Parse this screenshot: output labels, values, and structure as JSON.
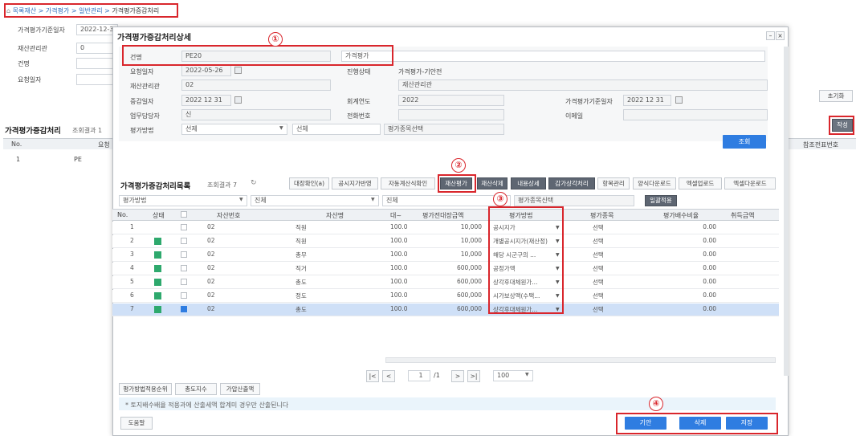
{
  "breadcrumb": [
    "목록재산",
    "가격평가",
    "일반관리",
    "가격평가증감처리"
  ],
  "bg_form": {
    "price_date_label": "가격평가기준일자",
    "price_date": "2022-12-31",
    "asset_type_label": "재산관리관",
    "asset_type_value": "0",
    "subject_label": "건명",
    "request_date_label": "요청일자",
    "reset_button": "초기화"
  },
  "bg_list": {
    "title": "가격평가증감처리",
    "result": "조회결과 1",
    "write_button": "작성",
    "cols": {
      "no": "No.",
      "req": "요청",
      "ref": "참조전표번호"
    },
    "row": {
      "no": "1",
      "val": "PE"
    }
  },
  "modal": {
    "title": "가격평가증감처리상세",
    "win_ctrls": {
      "min": "–",
      "close": "×"
    },
    "subject_label": "건명",
    "subject_value": "PE20",
    "subject_type": "가격평가",
    "request_date_label": "요청일자",
    "request_date": "2022-05-26",
    "status_label": "진행상태",
    "status_value": "가격평가-기안전",
    "asset_mgr_label": "재산관리관",
    "asset_mgr_value": "02",
    "asset_mgr_name": "재산관리관",
    "change_date_label": "증감일자",
    "change_date": "2022 12 31",
    "fiscal_year_label": "회계연도",
    "fiscal_year": "2022",
    "price_base_label": "가격평가기준일자",
    "price_base": "2022 12 31",
    "worker_label": "업무담당자",
    "worker": "신",
    "phone_label": "전화번호",
    "email_label": "이메일",
    "method_label": "평가방법",
    "method_value": "선제",
    "method_value2": "선체",
    "method_value3": "평가종목선택",
    "search_button": "조회",
    "list_title": "가격평가증감처리목록",
    "list_result": "조회결과 7",
    "toolbar": [
      "대장확인(a)",
      "공시지가반영",
      "자동계산식확인",
      "재산평가",
      "재산삭제",
      "내용상세",
      "감가상각처리",
      "항목관리",
      "양식다운로드",
      "엑셀업로드",
      "엑셀다운로드"
    ],
    "filter": {
      "f1": "평가방법",
      "f2": "진체",
      "f3": "진체",
      "f4": "평가종목신택",
      "apply": "일괄적용"
    },
    "table_headers": [
      "No.",
      "상태",
      "",
      "자산번호",
      "자산명",
      "대~",
      "평가전대장금액",
      "평가방법",
      "평가종목",
      "평가배수비율",
      "취득금액"
    ],
    "rows": [
      {
        "no": "1",
        "status": false,
        "checked": false,
        "code": "02",
        "name": "직원",
        "d": "100.0",
        "amount": "10,000",
        "method": "공시지가",
        "item": "선택",
        "ratio": "0.00"
      },
      {
        "no": "2",
        "status": true,
        "checked": false,
        "code": "02",
        "name": "직원",
        "d": "100.0",
        "amount": "10,000",
        "method": "개별공시지가(재산정)",
        "item": "선택",
        "ratio": "0.00"
      },
      {
        "no": "3",
        "status": true,
        "checked": false,
        "code": "02",
        "name": "총무",
        "d": "100.0",
        "amount": "10,000",
        "method": "해당 시군구의 ...",
        "item": "선택",
        "ratio": "0.00"
      },
      {
        "no": "4",
        "status": true,
        "checked": false,
        "code": "02",
        "name": "직거",
        "d": "100.0",
        "amount": "600,000",
        "method": "공정가액",
        "item": "선택",
        "ratio": "0.00"
      },
      {
        "no": "5",
        "status": true,
        "checked": false,
        "code": "02",
        "name": "총도",
        "d": "100.0",
        "amount": "600,000",
        "method": "상각후대체원가...",
        "item": "선택",
        "ratio": "0.00"
      },
      {
        "no": "6",
        "status": true,
        "checked": false,
        "code": "02",
        "name": "정도",
        "d": "100.0",
        "amount": "600,000",
        "method": "시가보상액(수택...",
        "item": "선택",
        "ratio": "0.00"
      },
      {
        "no": "7",
        "status": true,
        "checked": true,
        "code": "02",
        "name": "총도",
        "d": "100.0",
        "amount": "600,000",
        "method": "상각후대체원가...",
        "item": "선택",
        "ratio": "0.00"
      }
    ],
    "pager": {
      "first": "|<",
      "prev": "<",
      "page": "1",
      "of": "/1",
      "next": ">",
      "last": ">|",
      "size": "100"
    },
    "bottom_tabs": [
      "평가방법적용순위",
      "총도지수",
      "가압산출액"
    ],
    "note": "* 토지배수배율 적용과에 산출세액 합계미 경우만 산출된니다",
    "help": "도움말",
    "actions": {
      "draft": "기안",
      "delete": "삭제",
      "save": "저장"
    }
  },
  "callouts": [
    "①",
    "②",
    "③",
    "④"
  ]
}
